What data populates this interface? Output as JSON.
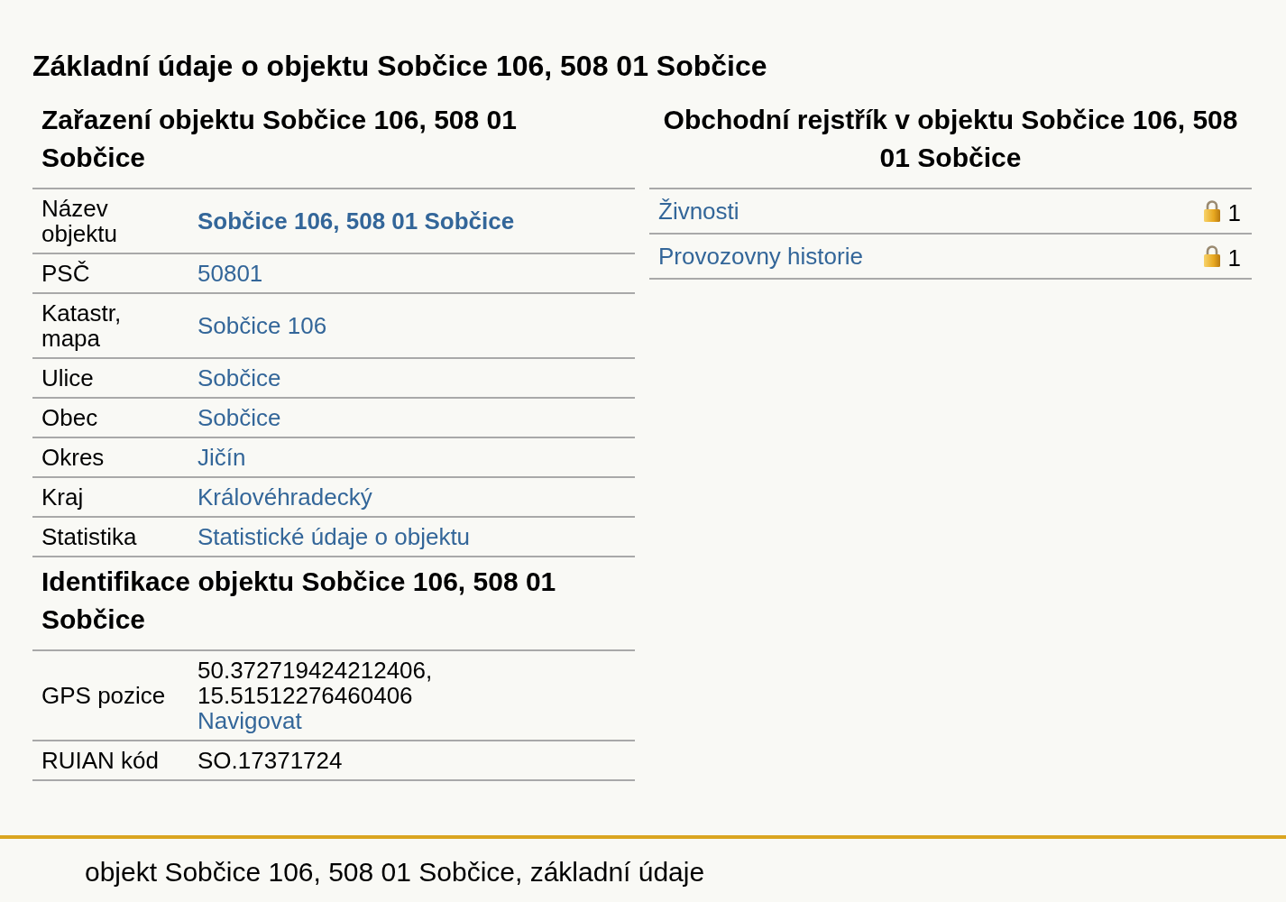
{
  "page_title": "Základní údaje o objektu Sobčice 106, 508 01 Sobčice",
  "classification": {
    "heading": "Zařazení objektu Sobčice 106, 508 01 Sobčice",
    "rows": [
      {
        "label": "Název objektu",
        "value": "Sobčice 106, 508 01 Sobčice",
        "kind": "strong-link"
      },
      {
        "label": "PSČ",
        "value": "50801",
        "kind": "link"
      },
      {
        "label": "Katastr, mapa",
        "value": "Sobčice 106",
        "kind": "link"
      },
      {
        "label": "Ulice",
        "value": "Sobčice",
        "kind": "link"
      },
      {
        "label": "Obec",
        "value": "Sobčice",
        "kind": "link"
      },
      {
        "label": "Okres",
        "value": "Jičín",
        "kind": "link"
      },
      {
        "label": "Kraj",
        "value": "Královéhradecký",
        "kind": "link"
      },
      {
        "label": "Statistika",
        "value": "Statistické údaje o objektu",
        "kind": "link"
      }
    ]
  },
  "identification": {
    "heading": "Identifikace objektu Sobčice 106, 508 01 Sobčice",
    "rows": [
      {
        "label": "GPS pozice",
        "value": "50.372719424212406,\n15.51512276460406",
        "link": "Navigovat",
        "kind": "gps"
      },
      {
        "label": "RUIAN kód",
        "value": "SO.17371724",
        "kind": "text"
      }
    ]
  },
  "business_register": {
    "heading": "Obchodní rejstřík v objektu Sobčice 106, 508 01 Sobčice",
    "rows": [
      {
        "label": "Živnosti",
        "locked": true,
        "count": "1"
      },
      {
        "label": "Provozovny historie",
        "locked": true,
        "count": "1"
      }
    ]
  },
  "footer": {
    "text": "objekt Sobčice 106, 508 01 Sobčice, základní údaje"
  }
}
